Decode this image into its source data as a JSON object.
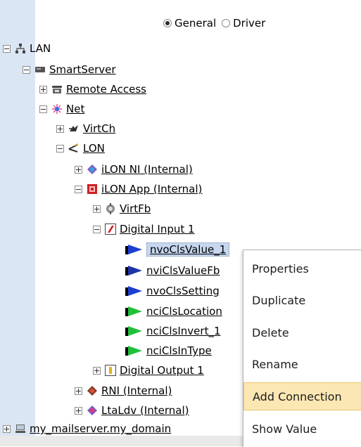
{
  "view_mode": {
    "options": [
      {
        "label": "General",
        "selected": true
      },
      {
        "label": "Driver",
        "selected": false
      }
    ]
  },
  "tree": {
    "lan": {
      "label": "LAN",
      "toggle": "minus"
    },
    "smartserver": {
      "label": "SmartServer",
      "toggle": "minus"
    },
    "remote_access": {
      "label": "Remote Access",
      "toggle": "plus"
    },
    "net": {
      "label": "Net",
      "toggle": "minus"
    },
    "virtch": {
      "label": "VirtCh",
      "toggle": "plus"
    },
    "lon": {
      "label": "LON",
      "toggle": "minus"
    },
    "ilon_ni": {
      "label": "iLON NI (Internal)",
      "toggle": "plus"
    },
    "ilon_app": {
      "label": "iLON App (Internal)",
      "toggle": "minus"
    },
    "virtfb": {
      "label": "VirtFb",
      "toggle": "plus"
    },
    "digital_input_1": {
      "label": "Digital Input 1",
      "toggle": "minus"
    },
    "datapoints": [
      {
        "label": "nvoClsValue_1",
        "selected": true
      },
      {
        "label": "nviClsValueFb"
      },
      {
        "label": "nvoClsSetting"
      },
      {
        "label": "nciClsLocation"
      },
      {
        "label": "nciClsInvert_1"
      },
      {
        "label": "nciClsInType"
      }
    ],
    "digital_output_1": {
      "label": "Digital Output 1",
      "toggle": "plus"
    },
    "rni": {
      "label": "RNI (Internal)",
      "toggle": "plus"
    },
    "ltaldv": {
      "label": "LtaLdv (Internal)",
      "toggle": "plus"
    },
    "mailserver": {
      "label": "my_mailserver.my_domain",
      "toggle": "plus"
    }
  },
  "context_menu": {
    "items": [
      {
        "label": "Properties"
      },
      {
        "label": "Duplicate"
      },
      {
        "label": "Delete"
      },
      {
        "label": "Rename"
      },
      {
        "label": "Add Connection",
        "highlighted": true
      },
      {
        "label": "Show Value"
      }
    ]
  },
  "colors": {
    "tree_strip": "#dbe6f4",
    "selection": "#c6d7ef",
    "menu_highlight": "#fbe7b3",
    "output_pointer": "#1c3fd1",
    "config_pointer": "#22c03a"
  }
}
